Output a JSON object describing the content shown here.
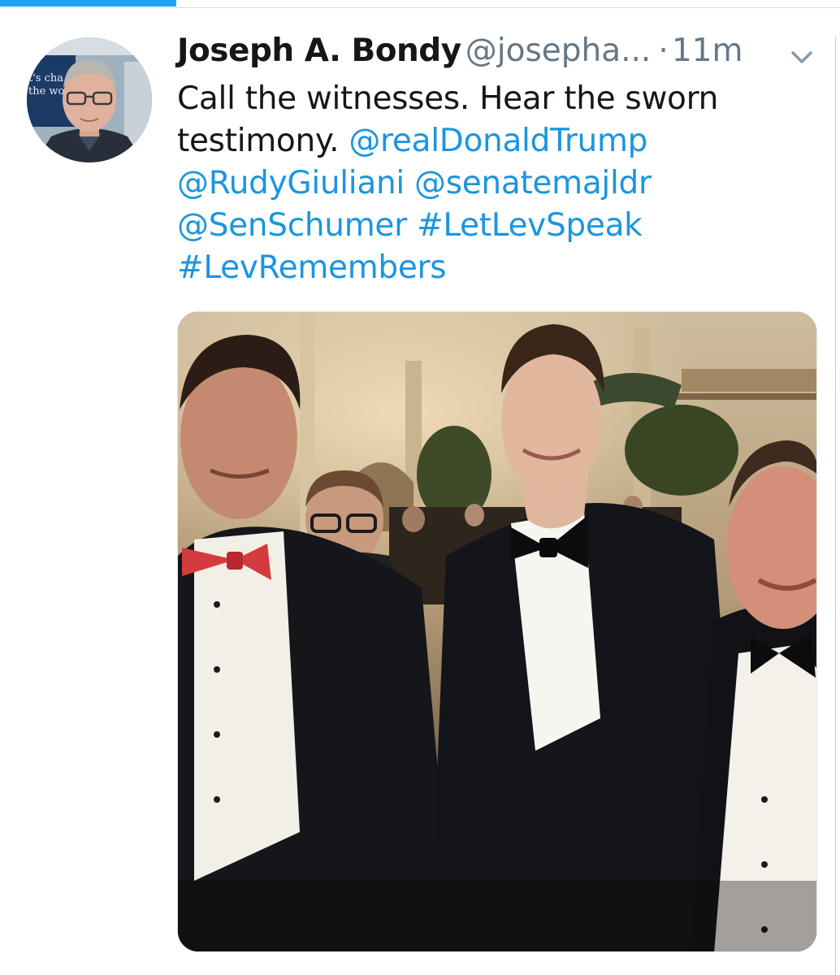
{
  "tweet": {
    "display_name": "Joseph A. Bondy",
    "handle": "@josepha...",
    "separator": "·",
    "time": "11m",
    "text_line1": "Call the witnesses. Hear the sworn",
    "text_line2_plain": "testimony.",
    "mention_trump": "@realDonaldTrump",
    "mention_giuliani": "@RudyGiuliani",
    "mention_majldr": "@senatemajldr",
    "mention_schumer": "@SenSchumer",
    "hashtag_letlevspeak": "#LetLevSpeak",
    "hashtag_levremembers": "#LevRemembers"
  },
  "avatar": {
    "background_text_1": "t's cha",
    "background_text_2": "the wo"
  },
  "colors": {
    "accent": "#1da1f2",
    "link": "#1b95e0",
    "text": "#14171a",
    "secondary": "#657786"
  },
  "icons": {
    "menu": "chevron-down-icon"
  },
  "load_progress": 0.21
}
